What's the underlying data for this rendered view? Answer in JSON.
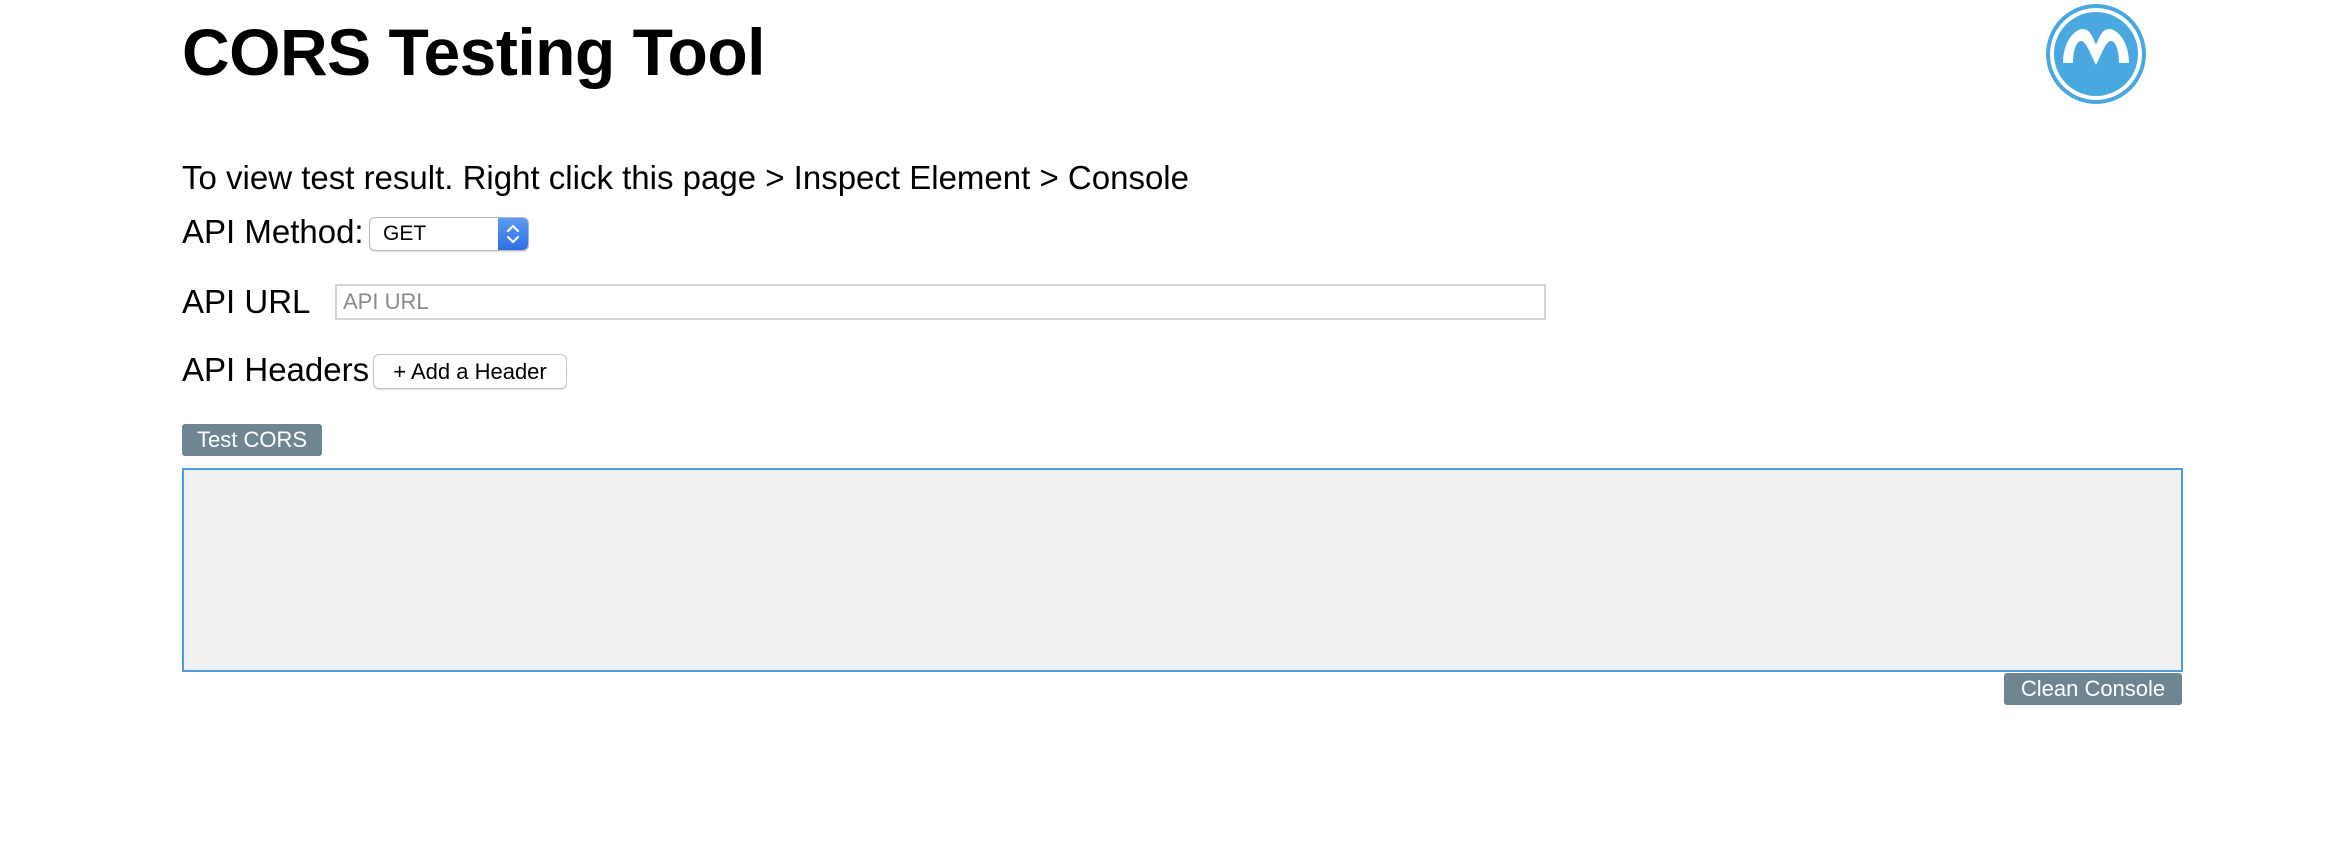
{
  "header": {
    "title": "CORS Testing Tool"
  },
  "logo": {
    "icon": "mulesoft-logo-icon",
    "color": "#4aa8e0"
  },
  "instructions": "To view test result. Right click this page > Inspect Element > Console",
  "form": {
    "method_label": "API Method:",
    "method_value": "GET",
    "url_label": "API URL",
    "url_placeholder": "API URL",
    "url_value": "",
    "headers_label": "API Headers",
    "add_header_label": "+ Add a Header"
  },
  "actions": {
    "test_label": "Test CORS",
    "clean_label": "Clean Console",
    "button_color": "#6f8592"
  },
  "console": {
    "content": "",
    "border_color": "#4a9fe0",
    "background": "#f1f1f1"
  }
}
